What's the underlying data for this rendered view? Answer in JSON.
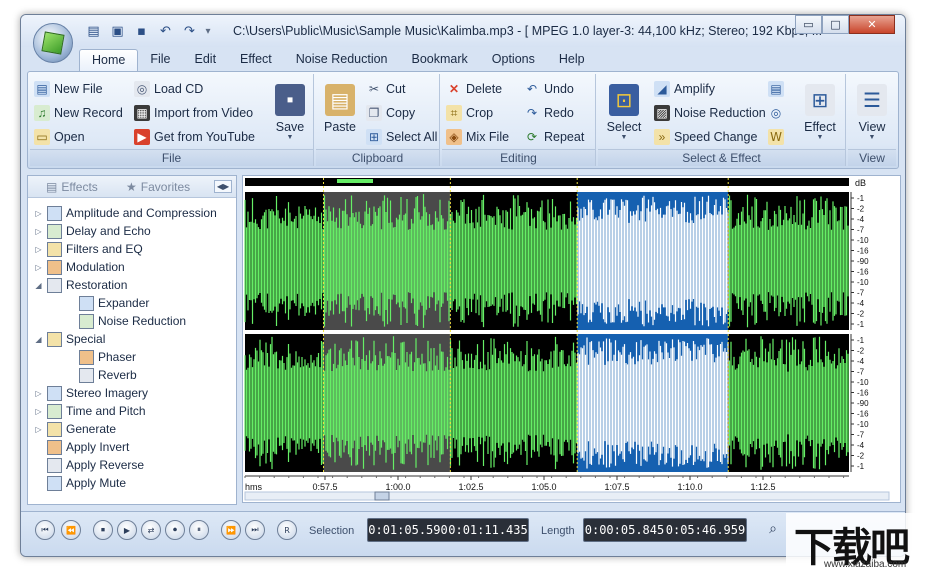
{
  "window": {
    "title": "C:\\Users\\Public\\Music\\Sample Music\\Kalimba.mp3 - [ MPEG 1.0 layer-3: 44,100 kHz; Stereo; 192 Kbps; ...",
    "controls": {
      "minimize": "▭",
      "maximize": "□",
      "close": "✕"
    }
  },
  "quick_access": [
    {
      "name": "new-icon",
      "glyph": "▤"
    },
    {
      "name": "open-icon",
      "glyph": "▣"
    },
    {
      "name": "save-icon",
      "glyph": "▪"
    },
    {
      "name": "undo-icon",
      "glyph": "↶"
    },
    {
      "name": "redo-icon",
      "glyph": "↷"
    }
  ],
  "tabs": [
    "Home",
    "File",
    "Edit",
    "Effect",
    "Noise Reduction",
    "Bookmark",
    "Options",
    "Help"
  ],
  "active_tab": "Home",
  "ribbon": {
    "file": {
      "label": "File",
      "new_file": "New File",
      "new_record": "New Record",
      "open": "Open",
      "load_cd": "Load CD",
      "import_video": "Import from Video",
      "get_youtube": "Get from YouTube",
      "save": "Save"
    },
    "clipboard": {
      "label": "Clipboard",
      "paste": "Paste",
      "cut": "Cut",
      "copy": "Copy",
      "select_all": "Select All"
    },
    "editing": {
      "label": "Editing",
      "delete": "Delete",
      "crop": "Crop",
      "mix_file": "Mix File",
      "undo": "Undo",
      "redo": "Redo",
      "repeat": "Repeat"
    },
    "select_effect": {
      "label": "Select & Effect",
      "select": "Select",
      "amplify": "Amplify",
      "noise_reduction": "Noise Reduction",
      "speed_change": "Speed Change",
      "effect": "Effect"
    },
    "view": {
      "label": "View",
      "view": "View"
    }
  },
  "panel": {
    "tab_effects": "Effects",
    "tab_favorites": "Favorites",
    "tree": [
      {
        "label": "Amplitude and Compression",
        "level": 0,
        "expander": "▷",
        "icon": "amplitude-icon"
      },
      {
        "label": "Delay and Echo",
        "level": 0,
        "expander": "▷",
        "icon": "delay-icon"
      },
      {
        "label": "Filters and EQ",
        "level": 0,
        "expander": "▷",
        "icon": "filters-icon"
      },
      {
        "label": "Modulation",
        "level": 0,
        "expander": "▷",
        "icon": "modulation-icon"
      },
      {
        "label": "Restoration",
        "level": 0,
        "expander": "◢",
        "icon": "restoration-icon"
      },
      {
        "label": "Expander",
        "level": 1,
        "expander": "",
        "icon": "expander-icon"
      },
      {
        "label": "Noise Reduction",
        "level": 1,
        "expander": "",
        "icon": "noise-reduction-icon"
      },
      {
        "label": "Special",
        "level": 0,
        "expander": "◢",
        "icon": "special-icon"
      },
      {
        "label": "Phaser",
        "level": 1,
        "expander": "",
        "icon": "phaser-icon"
      },
      {
        "label": "Reverb",
        "level": 1,
        "expander": "",
        "icon": "reverb-icon"
      },
      {
        "label": "Stereo Imagery",
        "level": 0,
        "expander": "▷",
        "icon": "stereo-icon"
      },
      {
        "label": "Time and Pitch",
        "level": 0,
        "expander": "▷",
        "icon": "time-pitch-icon"
      },
      {
        "label": "Generate",
        "level": 0,
        "expander": "▷",
        "icon": "generate-icon"
      },
      {
        "label": "Apply Invert",
        "level": 0,
        "expander": "",
        "icon": "invert-icon"
      },
      {
        "label": "Apply Reverse",
        "level": 0,
        "expander": "",
        "icon": "reverse-icon"
      },
      {
        "label": "Apply Mute",
        "level": 0,
        "expander": "",
        "icon": "mute-icon"
      }
    ]
  },
  "waveform": {
    "db_label": "dB",
    "db_scale": [
      "-1",
      "-2",
      "-4",
      "-7",
      "-10",
      "-16",
      "-90",
      "-16",
      "-10",
      "-7",
      "-4",
      "-2",
      "-1"
    ],
    "timeline_unit": "hms",
    "timeline_labels": [
      "0:57.5",
      "1:00.0",
      "1:02.5",
      "1:05.0",
      "1:07.5",
      "1:10.0",
      "1:12.5"
    ],
    "selection_fraction": [
      0.55,
      0.8
    ],
    "highlight_fraction": [
      0.13,
      0.34
    ],
    "colors": {
      "wave": "#66ee66",
      "selection_bg": "#1560b0",
      "selection_wave": "#ffffff",
      "highlight_bg": "#4a4a4a",
      "background": "#000000"
    }
  },
  "transport": {
    "buttons": [
      "⏮",
      "⏪",
      "⏹",
      "▶",
      "⇄",
      "⏺",
      "⏸",
      "⏩",
      "⏭",
      "R"
    ],
    "selection_label": "Selection",
    "selection_start": "0:01:05.590",
    "selection_end": "0:01:11.435",
    "length_label": "Length",
    "length_value": "0:00:05.845",
    "total_value": "0:05:46.959"
  },
  "watermark": {
    "text": "下载吧",
    "url": "www.xiazaiba.com"
  }
}
